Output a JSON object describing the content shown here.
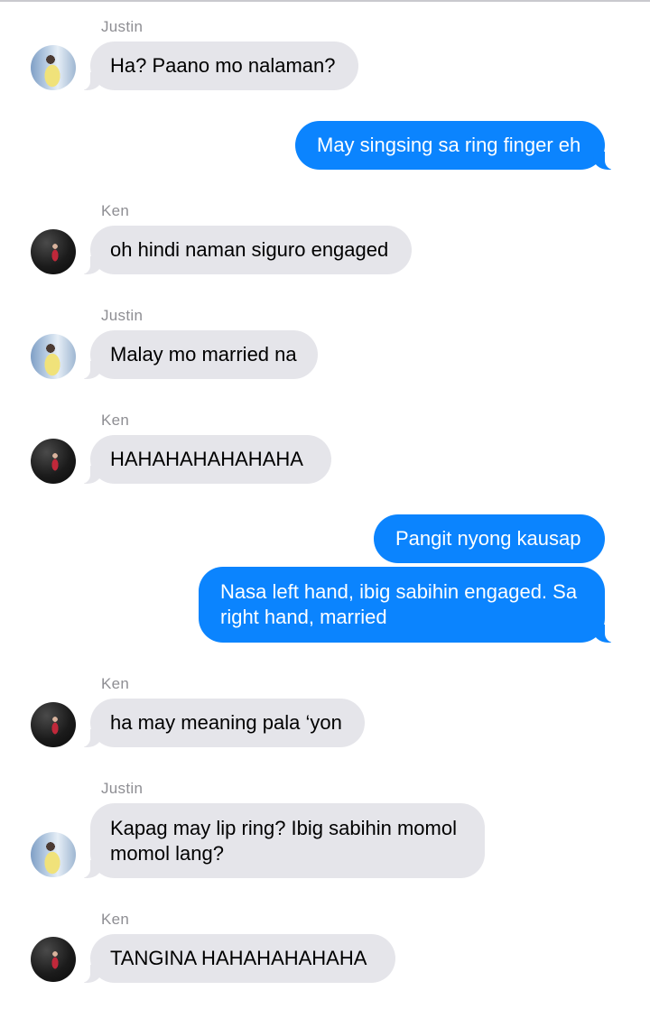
{
  "colors": {
    "incoming_bubble": "#e5e5ea",
    "outgoing_bubble": "#0b84fe",
    "sender_name": "#8e8e93"
  },
  "messages": [
    {
      "direction": "incoming",
      "sender": "Justin",
      "avatar": "justin-avatar",
      "text": "Ha? Paano mo nalaman?"
    },
    {
      "direction": "outgoing",
      "text": "May singsing sa ring finger eh"
    },
    {
      "direction": "incoming",
      "sender": "Ken",
      "avatar": "ken-avatar",
      "text": "oh hindi naman siguro engaged"
    },
    {
      "direction": "incoming",
      "sender": "Justin",
      "avatar": "justin-avatar",
      "text": "Malay mo married na"
    },
    {
      "direction": "incoming",
      "sender": "Ken",
      "avatar": "ken-avatar",
      "text": "HAHAHAHAHAHAHA"
    },
    {
      "direction": "outgoing",
      "text": "Pangit nyong kausap"
    },
    {
      "direction": "outgoing",
      "text": "Nasa left hand, ibig sabihin engaged. Sa right hand, married"
    },
    {
      "direction": "incoming",
      "sender": "Ken",
      "avatar": "ken-avatar",
      "text": "ha may meaning pala ‘yon"
    },
    {
      "direction": "incoming",
      "sender": "Justin",
      "avatar": "justin-avatar",
      "text": "Kapag may lip ring? Ibig sabihin momol momol lang?"
    },
    {
      "direction": "incoming",
      "sender": "Ken",
      "avatar": "ken-avatar",
      "text": "TANGINA HAHAHAHAHAHA"
    }
  ]
}
